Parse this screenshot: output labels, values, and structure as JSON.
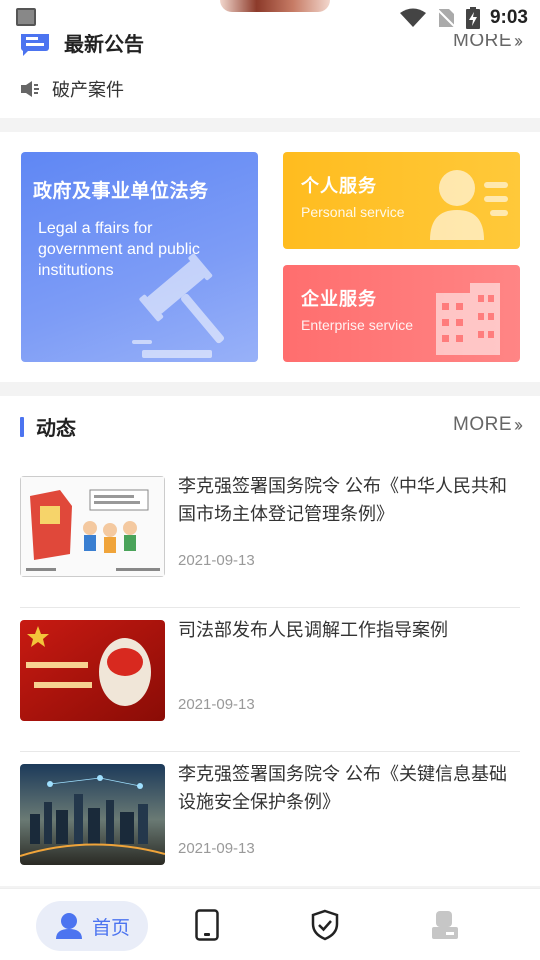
{
  "status_bar": {
    "time": "9:03"
  },
  "notice": {
    "title": "最新公告",
    "more_label": "MORE",
    "item_text": "破产案件"
  },
  "services": {
    "gov": {
      "title": "政府及事业单位法务",
      "subtitle": "Legal a ffairs for government and public institutions"
    },
    "personal": {
      "title": "个人服务",
      "subtitle": "Personal service"
    },
    "enterprise": {
      "title": "企业服务",
      "subtitle": "Enterprise service"
    }
  },
  "news": {
    "title": "动态",
    "more_label": "MORE",
    "items": [
      {
        "title": "李克强签署国务院令 公布《中华人民共和国市场主体登记管理条例》",
        "date": "2021-09-13"
      },
      {
        "title": "司法部发布人民调解工作指导案例",
        "date": "2021-09-13"
      },
      {
        "title": "李克强签署国务院令 公布《关键信息基础设施安全保护条例》",
        "date": "2021-09-13"
      }
    ]
  },
  "bottom_nav": {
    "home_label": "首页",
    "items": [
      "home-icon",
      "phone-icon",
      "shield-check-icon",
      "profile-icon"
    ]
  },
  "colors": {
    "accent": "#4c74f0",
    "gov_card": "#6b8ff5",
    "personal_card": "#ffc02a",
    "enterprise_card": "#ff7474"
  }
}
